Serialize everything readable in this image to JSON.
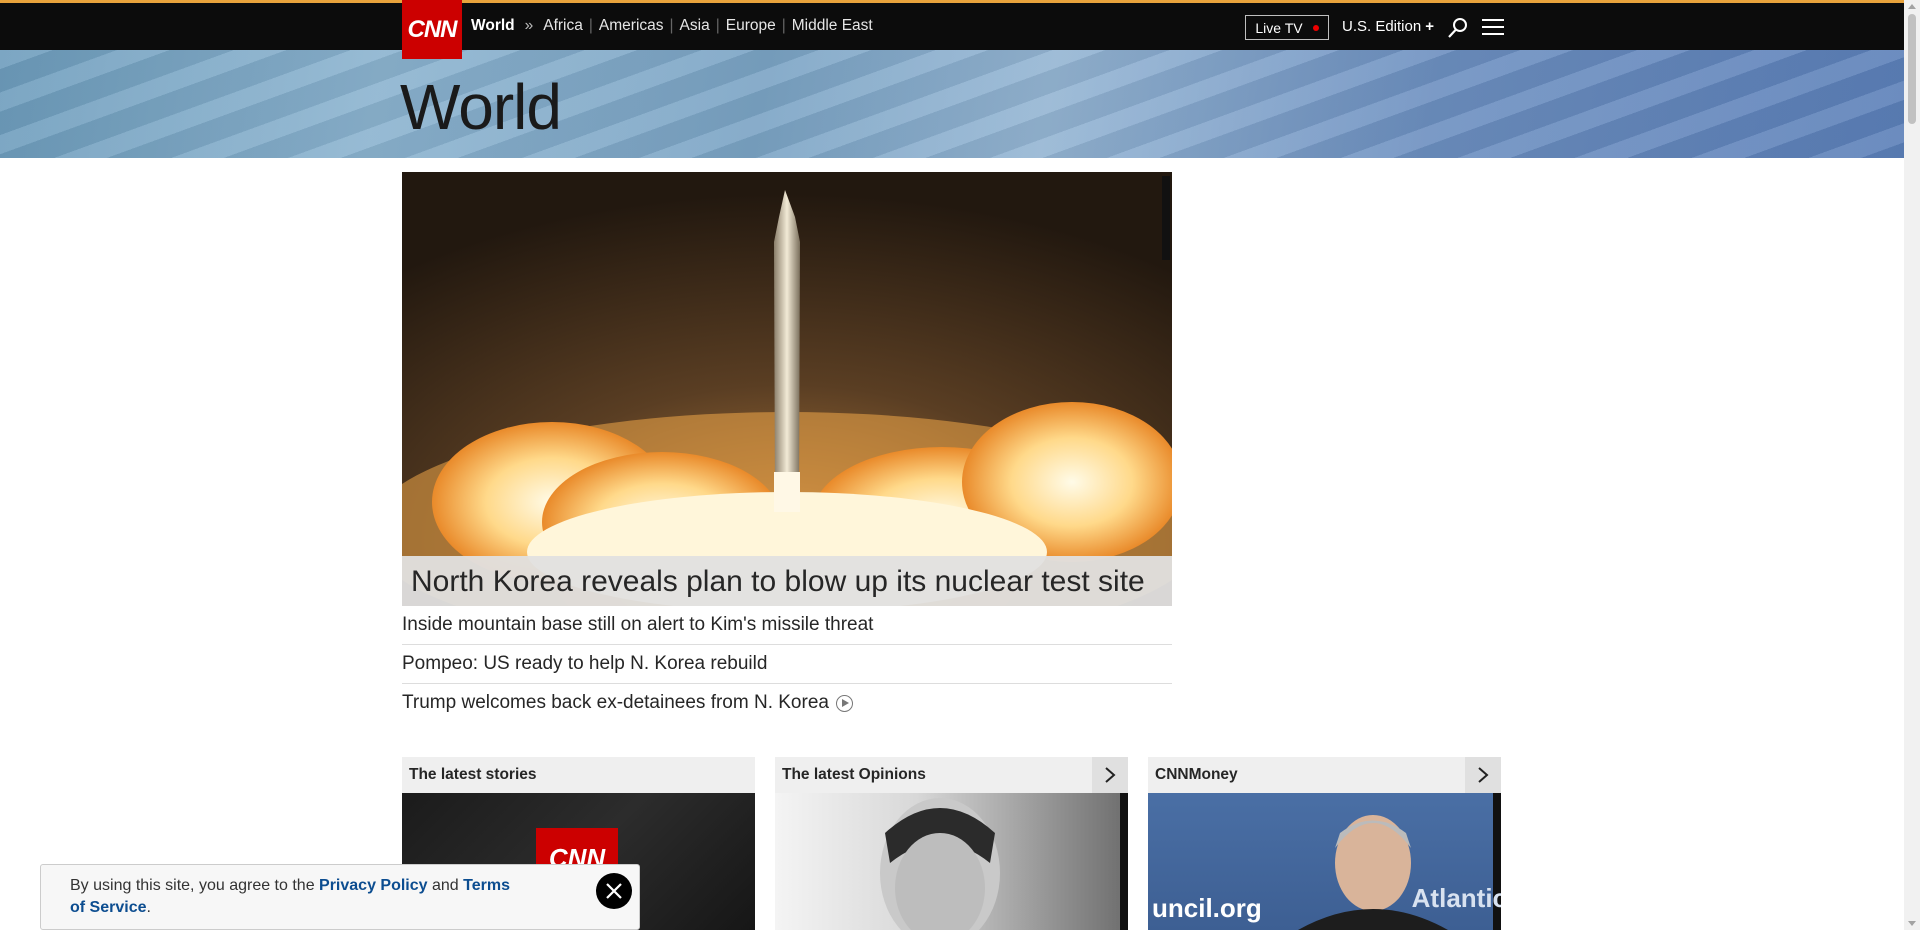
{
  "logo": {
    "text": "CNN"
  },
  "nav": {
    "section": "World",
    "arrow": "»",
    "separator": "|",
    "regions": [
      "Africa",
      "Americas",
      "Asia",
      "Europe",
      "Middle East"
    ]
  },
  "header": {
    "live_tv": "Live TV",
    "edition": "U.S. Edition",
    "edition_plus": "+",
    "live_dot_color": "#e00000",
    "icons": [
      "search-icon",
      "hamburger-menu-icon"
    ]
  },
  "page": {
    "title": "World"
  },
  "hero": {
    "headline": "North Korea reveals plan to blow up its nuclear test site",
    "image": "missile-launch-photo"
  },
  "related": [
    {
      "text": "Inside mountain base still on alert to Kim's missile threat",
      "video": false
    },
    {
      "text": "Pompeo: US ready to help N. Korea rebuild",
      "video": false
    },
    {
      "text": "Trump welcomes back ex-detainees from N. Korea",
      "video": true
    }
  ],
  "cards": [
    {
      "title": "The latest stories",
      "has_arrow": false,
      "image_text": "CNN"
    },
    {
      "title": "The latest Opinions",
      "has_arrow": true
    },
    {
      "title": "CNNMoney",
      "has_arrow": true,
      "image_text_left": "uncil.org",
      "image_text_right": "Atlantic"
    }
  ],
  "cookie": {
    "prefix": "By using this site, you agree to the ",
    "privacy": "Privacy Policy",
    "middle": " and ",
    "terms": "Terms of Service",
    "suffix": "."
  },
  "colors": {
    "brand": "#cc0000",
    "topbar": "#0c0c0c",
    "accent_strip": "#e8a33c",
    "link": "#0c4d90"
  }
}
